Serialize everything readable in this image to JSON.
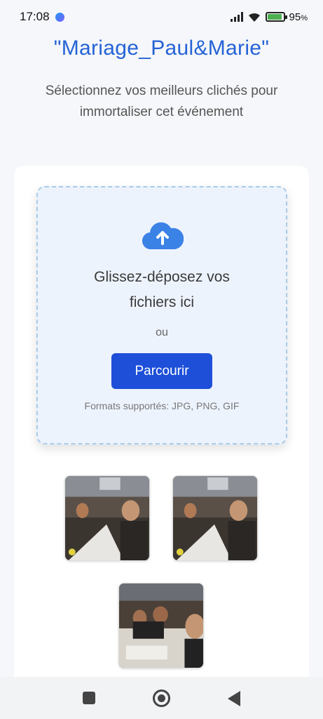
{
  "status_bar": {
    "time": "17:08",
    "battery_percent": "95",
    "battery_unit": "%",
    "battery_level": 0.95,
    "icons": [
      "messenger-icon",
      "signal-icon",
      "wifi-icon",
      "battery-charging-icon"
    ]
  },
  "page": {
    "title": "\"Mariage_Paul&Marie\"",
    "subtitle": "Sélectionnez vos meilleurs clichés pour immortaliser cet événement"
  },
  "upload": {
    "icon": "cloud-upload-icon",
    "title_line1": "Glissez-déposez vos",
    "title_line2": "fichiers ici",
    "or_text": "ou",
    "browse_label": "Parcourir",
    "formats_text": "Formats supportés: JPG, PNG, GIF",
    "accent_color": "#1d4fd8"
  },
  "photos": [
    {
      "name": "photo-1"
    },
    {
      "name": "photo-2"
    },
    {
      "name": "photo-3"
    }
  ],
  "nav_bar": {
    "icons": [
      "recent-apps-icon",
      "home-icon",
      "back-icon"
    ]
  }
}
